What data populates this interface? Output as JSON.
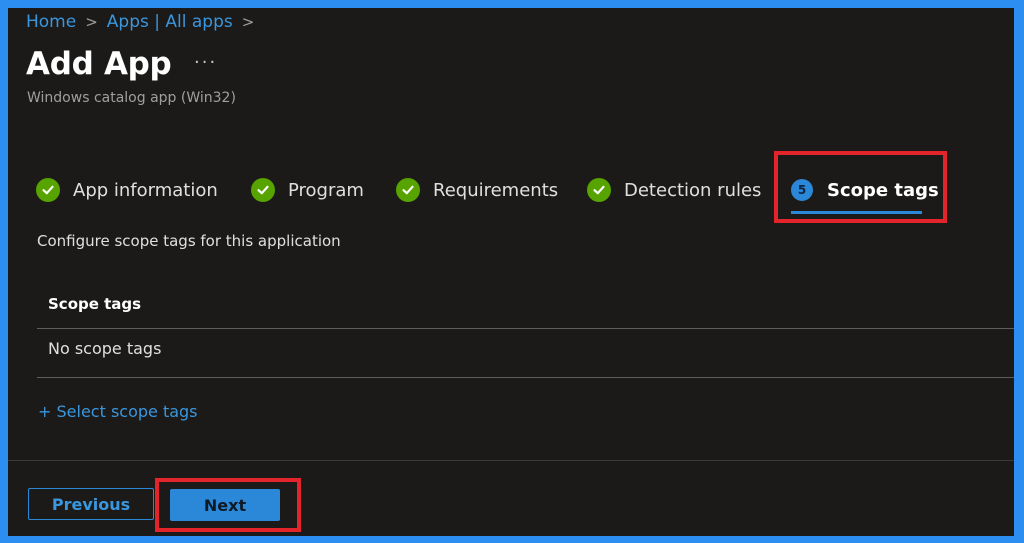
{
  "breadcrumb": {
    "home": "Home",
    "apps": "Apps | All apps"
  },
  "page": {
    "title": "Add App",
    "more": "···",
    "subtitle": "Windows catalog app (Win32)"
  },
  "tabs": [
    {
      "label": "App information",
      "status": "complete"
    },
    {
      "label": "Program",
      "status": "complete"
    },
    {
      "label": "Requirements",
      "status": "complete"
    },
    {
      "label": "Detection rules",
      "status": "complete"
    },
    {
      "label": "Scope tags",
      "status": "active",
      "step": "5"
    }
  ],
  "content": {
    "description": "Configure scope tags for this application",
    "table_header": "Scope tags",
    "empty_text": "No scope tags",
    "select_link": "+ Select scope tags"
  },
  "footer": {
    "previous_label": "Previous",
    "next_label": "Next"
  },
  "colors": {
    "accent": "#2b88d8",
    "complete": "#57a300",
    "highlight": "#e3242b",
    "background": "#1b1a19"
  }
}
